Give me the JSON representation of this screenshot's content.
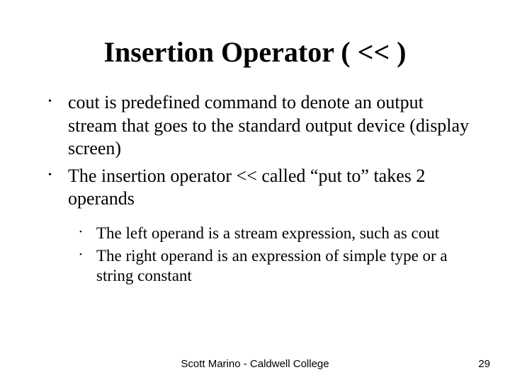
{
  "title": "Insertion Operator ( << )",
  "bullets": {
    "b1": "cout is predefined command to denote an output stream that goes to the standard output device (display screen)",
    "b2": "The insertion operator << called “put to” takes 2 operands"
  },
  "subbullets": {
    "s1": "The left operand is a stream expression, such as cout",
    "s2": "The right operand is an expression of simple type or a string constant"
  },
  "footer": {
    "center": "Scott Marino - Caldwell College",
    "page": "29"
  }
}
